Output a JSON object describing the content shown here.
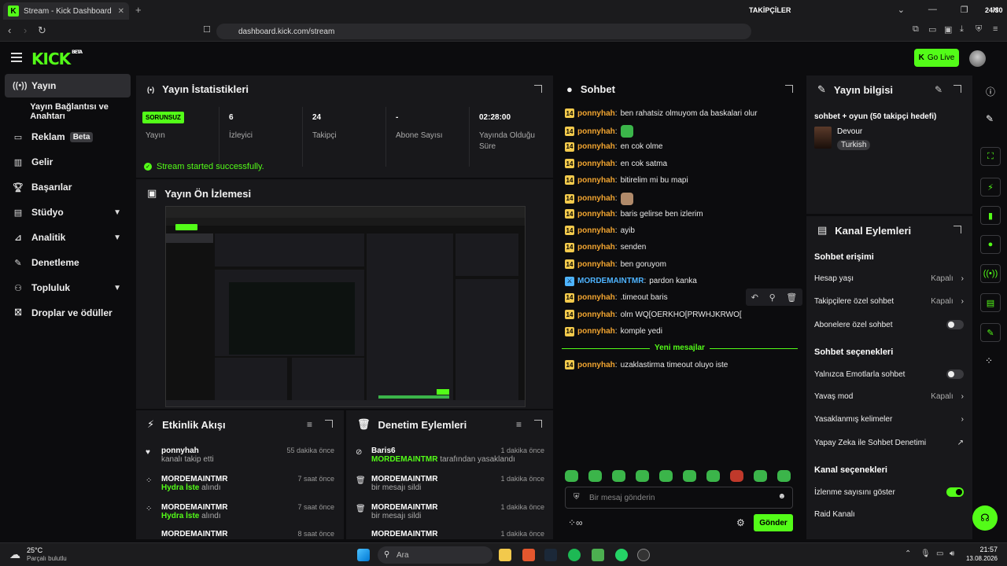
{
  "browser": {
    "tab_title": "Stream - Kick Dashboard",
    "url": "dashboard.kick.com/stream",
    "overlay_followers": "TAKİPÇİLER",
    "overlay_count": "24/30"
  },
  "header": {
    "logo": "KICK",
    "logo_badge": "BETA",
    "go_live": "Go Live"
  },
  "sidebar": {
    "items": [
      {
        "label": "Yayın",
        "icon": "broadcast-icon",
        "active": true
      },
      {
        "label": "Yayın Bağlantısı ve Anahtarı",
        "icon": ""
      },
      {
        "label": "Reklam",
        "icon": "tv-icon",
        "badge": "Beta"
      },
      {
        "label": "Gelir",
        "icon": "chart-icon"
      },
      {
        "label": "Başarılar",
        "icon": "trophy-icon"
      },
      {
        "label": "Stüdyo",
        "icon": "studio-icon",
        "chevron": true
      },
      {
        "label": "Analitik",
        "icon": "analytics-icon",
        "chevron": true
      },
      {
        "label": "Denetleme",
        "icon": "wrench-icon"
      },
      {
        "label": "Topluluk",
        "icon": "community-icon",
        "chevron": true
      },
      {
        "label": "Droplar ve ödüller",
        "icon": "gift-icon"
      }
    ]
  },
  "stats": {
    "title": "Yayın İstatistikleri",
    "status_badge": "SORUNSUZ",
    "status_label": "Yayın",
    "viewers_value": "6",
    "viewers_label": "İzleyici",
    "followers_value": "24",
    "followers_label": "Takipçi",
    "subs_value": "-",
    "subs_label": "Abone Sayısı",
    "uptime_value": "02:28:00",
    "uptime_label": "Yayında Olduğu Süre",
    "success": "Stream started successfully."
  },
  "preview": {
    "title": "Yayın Ön İzlemesi"
  },
  "activity": {
    "title": "Etkinlik Akışı",
    "items": [
      {
        "name": "ponnyhah",
        "detail": "kanalı takip etti",
        "time": "55 dakika önce"
      },
      {
        "name": "MORDEMAINTMR",
        "highlight": "Hydra İste",
        "detail": "alındı",
        "time": "7 saat önce"
      },
      {
        "name": "MORDEMAINTMR",
        "highlight": "Hydra İste",
        "detail": "alındı",
        "time": "7 saat önce"
      },
      {
        "name": "MORDEMAINTMR",
        "time": "8 saat önce"
      }
    ]
  },
  "moderation": {
    "title": "Denetim Eylemleri",
    "items": [
      {
        "name": "Baris6",
        "by": "MORDEMAINTMR",
        "detail": "tarafından yasaklandı",
        "time": "1 dakika önce"
      },
      {
        "name": "MORDEMAINTMR",
        "detail": "bir mesajı sildi",
        "time": "1 dakika önce"
      },
      {
        "name": "MORDEMAINTMR",
        "detail": "bir mesajı sildi",
        "time": "1 dakika önce"
      },
      {
        "name": "MORDEMAINTMR",
        "time": "1 dakika önce"
      }
    ]
  },
  "chat": {
    "title": "Sohbet",
    "messages": [
      {
        "badge": "14",
        "user": "ponnyhah",
        "text": "ben rahatsiz olmuyom da baskalari olur"
      },
      {
        "badge": "14",
        "user": "ponnyhah",
        "text": "",
        "emote": true
      },
      {
        "badge": "14",
        "user": "ponnyhah",
        "text": "en cok olme"
      },
      {
        "badge": "14",
        "user": "ponnyhah",
        "text": "en cok satma"
      },
      {
        "badge": "14",
        "user": "ponnyhah",
        "text": "bitirelim mi bu mapi"
      },
      {
        "badge": "14",
        "user": "ponnyhah",
        "text": "",
        "emote": true
      },
      {
        "badge": "14",
        "user": "ponnyhah",
        "text": "baris gelirse ben izlerim"
      },
      {
        "badge": "14",
        "user": "ponnyhah",
        "text": "ayib"
      },
      {
        "badge": "14",
        "user": "ponnyhah",
        "text": "senden"
      },
      {
        "badge": "14",
        "user": "ponnyhah",
        "text": "ben goruyom"
      },
      {
        "badge": "",
        "user": "MORDEMAINTMR",
        "text": "pardon kanka",
        "mod": true
      },
      {
        "badge": "14",
        "user": "ponnyhah",
        "text": ".timeout baris"
      },
      {
        "badge": "14",
        "user": "ponnyhah",
        "text": "olm WQ[OERKHO[PRWHJKRWO["
      },
      {
        "badge": "14",
        "user": "ponnyhah",
        "text": "komple yedi"
      }
    ],
    "new_messages_label": "Yeni mesajlar",
    "after_messages": [
      {
        "badge": "14",
        "user": "ponnyhah",
        "text": "uzaklastirma timeout oluyo iste"
      }
    ],
    "input_placeholder": "Bir mesaj gönderin",
    "send_label": "Gönder"
  },
  "stream_info": {
    "title": "Yayın bilgisi",
    "stream_title": "sohbet + oyun (50 takipçi hedefi)",
    "game": "Devour",
    "language": "Turkish"
  },
  "channel_actions": {
    "title": "Kanal Eylemleri",
    "chat_access_heading": "Sohbet erişimi",
    "account_age_label": "Hesap yaşı",
    "account_age_value": "Kapalı",
    "followers_only_label": "Takipçilere özel sohbet",
    "followers_only_value": "Kapalı",
    "subs_only_label": "Abonelere özel sohbet",
    "chat_options_heading": "Sohbet seçenekleri",
    "emote_only_label": "Yalnızca Emotlarla sohbet",
    "slow_mode_label": "Yavaş mod",
    "slow_mode_value": "Kapalı",
    "banned_words_label": "Yasaklanmış kelimeler",
    "ai_mod_label": "Yapay Zeka ile Sohbet Denetimi",
    "channel_options_heading": "Kanal seçenekleri",
    "show_views_label": "İzlenme sayısını göster",
    "raid_label": "Raid Kanalı"
  },
  "taskbar": {
    "weather_temp": "25°C",
    "weather_text": "Parçalı bulutlu",
    "search_placeholder": "Ara",
    "time": "21:57",
    "date": "13.08.2026"
  },
  "colors": {
    "accent": "#53fc18",
    "panel": "#18181b",
    "bg": "#0c0c0e",
    "username": "#f2a530",
    "mod_user": "#4eb4ff"
  }
}
